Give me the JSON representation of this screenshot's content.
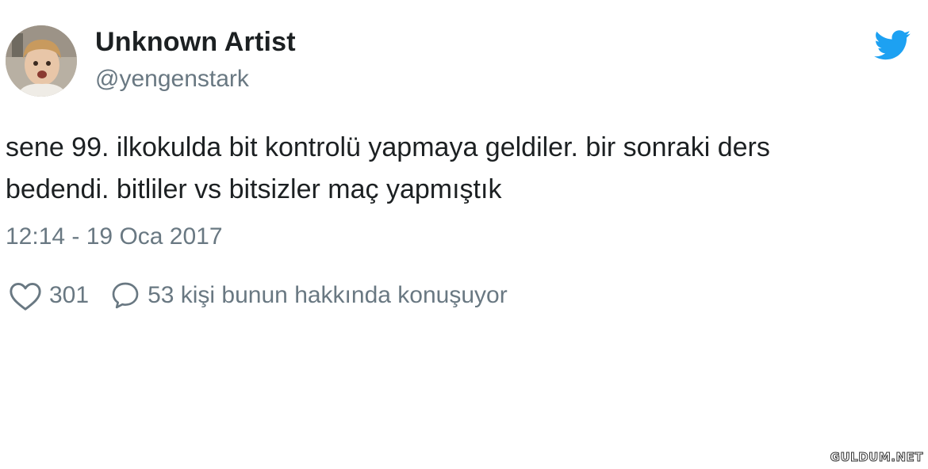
{
  "user": {
    "display_name": "Unknown Artist",
    "handle": "@yengenstark",
    "avatar_icon": "child-photo-avatar"
  },
  "tweet": {
    "text_lines": [
      "sene 99. ilkokulda bit kontrolü yapmaya geldiler. bir sonraki ders",
      "bedendi. bitliler vs bitsizler maç yapmıştık"
    ],
    "timestamp": "12:14 - 19 Oca 2017"
  },
  "stats": {
    "likes": "301",
    "replies_label": "53 kişi bunun hakkında konuşuyor"
  },
  "icons": {
    "brand": "twitter-bird-icon",
    "like": "heart-icon",
    "reply": "speech-bubble-icon"
  },
  "colors": {
    "brand": "#1da1f2",
    "text": "#1c2022",
    "muted": "#697882"
  },
  "watermark": "GULDUM.NET"
}
